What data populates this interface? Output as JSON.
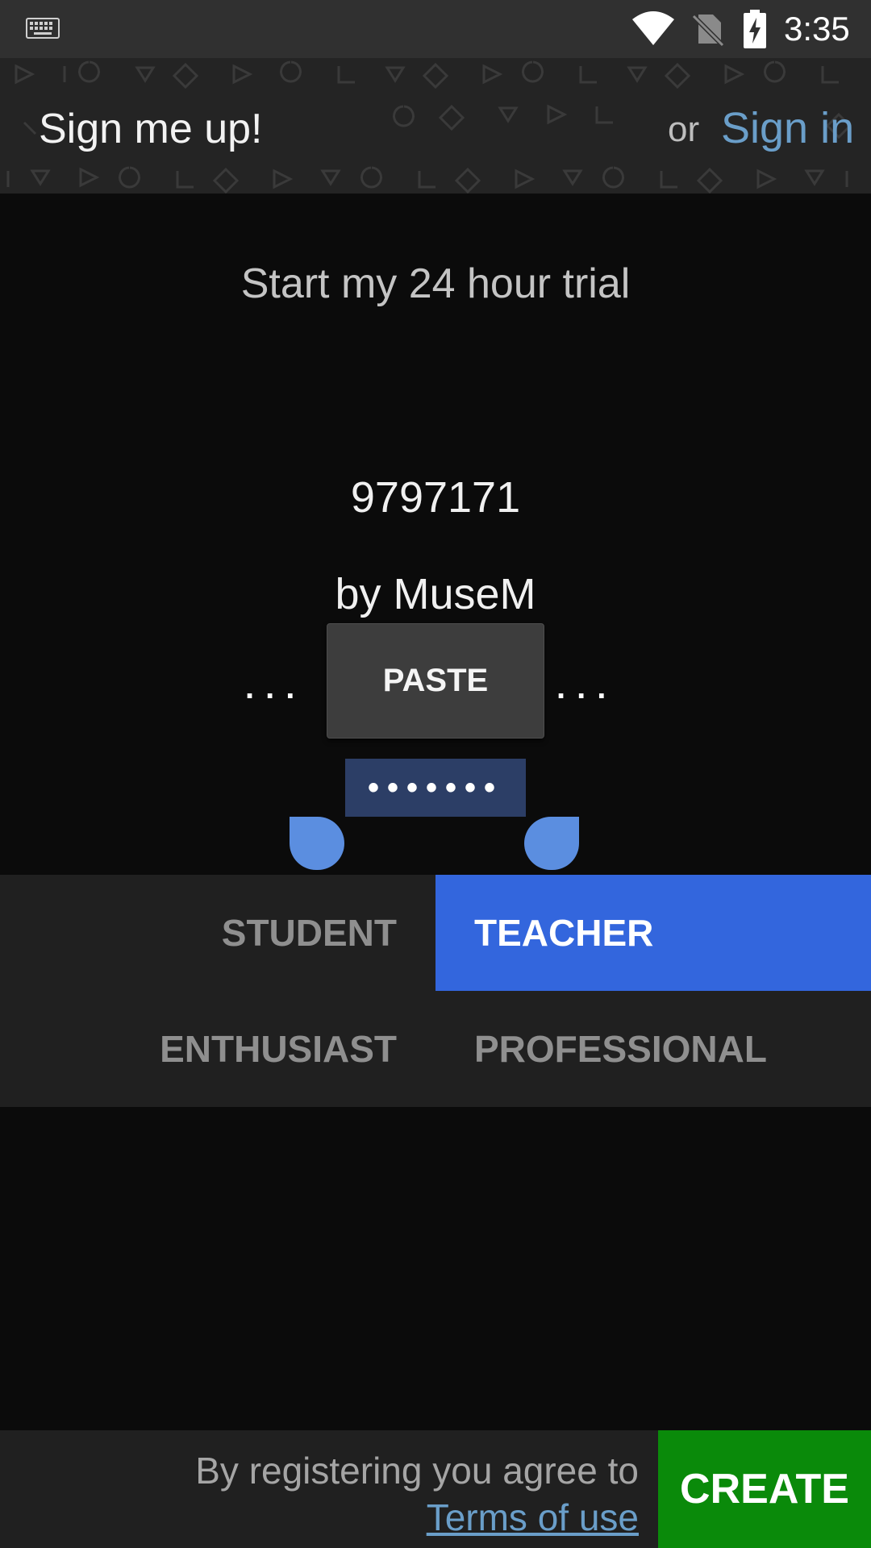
{
  "status_bar": {
    "time": "3:35",
    "icons": [
      "keyboard-icon",
      "wifi-icon",
      "no-sim-icon",
      "battery-charging-icon"
    ]
  },
  "header": {
    "title": "Sign me up!",
    "or_text": "or",
    "signin_label": "Sign in"
  },
  "main": {
    "trial_text": "Start my 24 hour trial",
    "code": "9797171",
    "by_text": "by MuseM",
    "paste_label": "PASTE",
    "ellipsis_left": "...",
    "ellipsis_right": "...",
    "password_masked": "•••••••"
  },
  "roles": {
    "student": "STUDENT",
    "teacher": "TEACHER",
    "enthusiast": "ENTHUSIAST",
    "professional": "PROFESSIONAL",
    "selected": "teacher"
  },
  "footer": {
    "agree_text": "By registering you agree to",
    "terms_label": "Terms of use",
    "create_label": "CREATE"
  },
  "colors": {
    "accent_blue": "#3366dd",
    "link_blue": "#6a9ec9",
    "create_green": "#0a8a0a",
    "selection_handle": "#5b8ee0",
    "selection_highlight": "#2c3e66"
  }
}
